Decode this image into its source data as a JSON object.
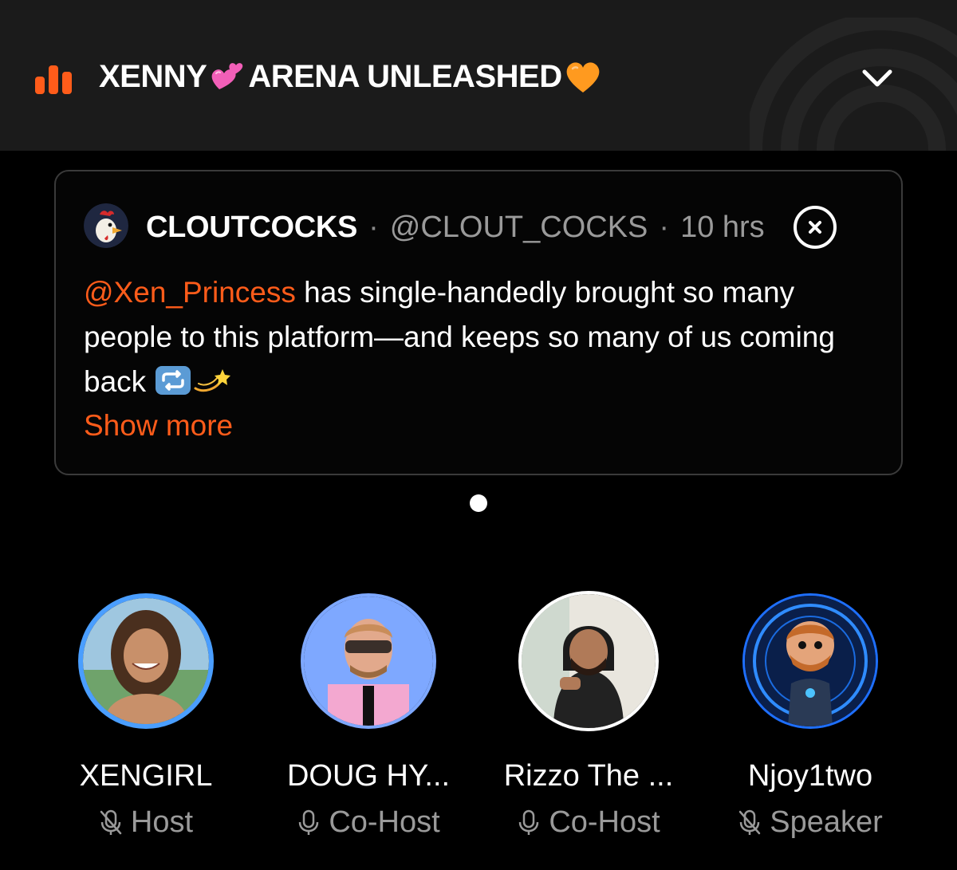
{
  "header": {
    "title_part1": "XENNY",
    "title_part2": "ARENA UNLEASHED",
    "accent": "#ff5c1a",
    "icons": [
      "bars-icon",
      "two-hearts-emoji",
      "orange-heart-emoji",
      "chevron-down-icon"
    ]
  },
  "pinned_post": {
    "author_name": "CLOUTCOCKS",
    "author_handle": "@CLOUT_COCKS",
    "separator": "·",
    "time_ago": "10 hrs",
    "mention": "@Xen_Princess",
    "text": " has single-handedly brought so many people to this platform—and keeps so many of us coming back ",
    "text_emojis": [
      "repeat-emoji",
      "dizzy-emoji"
    ],
    "show_more_label": "Show more",
    "mention_color": "#ff5c1a"
  },
  "pager": {
    "count": 1,
    "active": 0
  },
  "speakers": [
    {
      "name": "XENGIRL",
      "role": "Host",
      "mic": "muted",
      "ring_color": "#4a9eff"
    },
    {
      "name": "DOUG HY...",
      "role": "Co-Host",
      "mic": "on",
      "ring_color": "#7ea8ff"
    },
    {
      "name": "Rizzo The ...",
      "role": "Co-Host",
      "mic": "on",
      "ring_color": "#ffffff"
    },
    {
      "name": "Njoy1two",
      "role": "Speaker",
      "mic": "muted",
      "ring_color": "#1e6fff"
    }
  ]
}
